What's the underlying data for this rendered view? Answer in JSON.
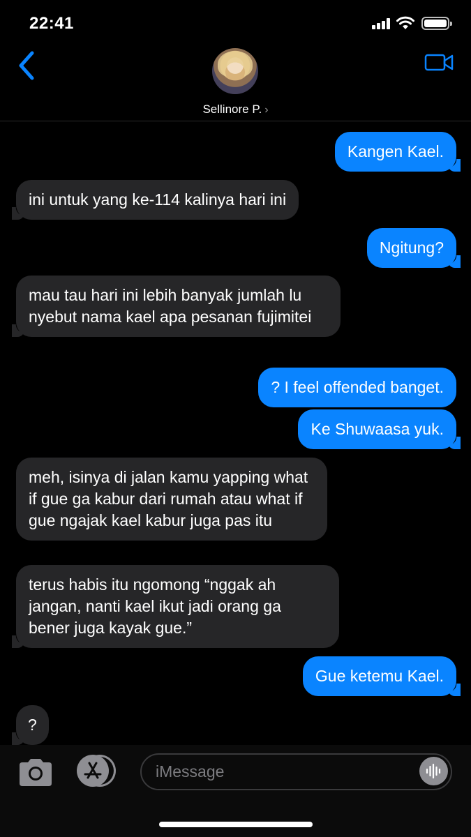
{
  "status_bar": {
    "time": "22:41",
    "battery_level": 1.0
  },
  "header": {
    "contact_name": "Sellinore P.",
    "contact_chevron": "›",
    "back_icon": "chevron-left-icon",
    "video_icon": "video-camera-icon"
  },
  "colors": {
    "outgoing_bubble": "#0a84ff",
    "incoming_bubble": "#262628",
    "accent": "#0a84ff",
    "background": "#000000"
  },
  "messages": [
    {
      "direction": "outgoing",
      "text": "Kangen Kael."
    },
    {
      "direction": "incoming",
      "text": "ini untuk yang ke-114 kalinya hari ini"
    },
    {
      "direction": "outgoing",
      "text": "Ngitung?"
    },
    {
      "direction": "incoming",
      "text": "mau tau hari ini lebih banyak jumlah lu nyebut nama kael apa pesanan fujimitei"
    },
    {
      "direction": "outgoing",
      "text": "? I feel offended banget."
    },
    {
      "direction": "outgoing",
      "text": "Ke Shuwaasa yuk."
    },
    {
      "direction": "incoming",
      "text": "meh, isinya di jalan kamu yapping what if gue ga kabur dari rumah atau what if gue ngajak kael kabur juga pas itu"
    },
    {
      "direction": "incoming",
      "text": "terus habis itu ngomong “nggak ah jangan, nanti kael ikut jadi orang ga bener juga kayak gue.”"
    },
    {
      "direction": "outgoing",
      "text": "Gue ketemu Kael."
    },
    {
      "direction": "incoming",
      "text": "?"
    }
  ],
  "input_bar": {
    "placeholder": "iMessage",
    "camera_icon": "camera-icon",
    "apps_icon": "app-store-icon",
    "audio_icon": "audio-waveform-icon"
  }
}
